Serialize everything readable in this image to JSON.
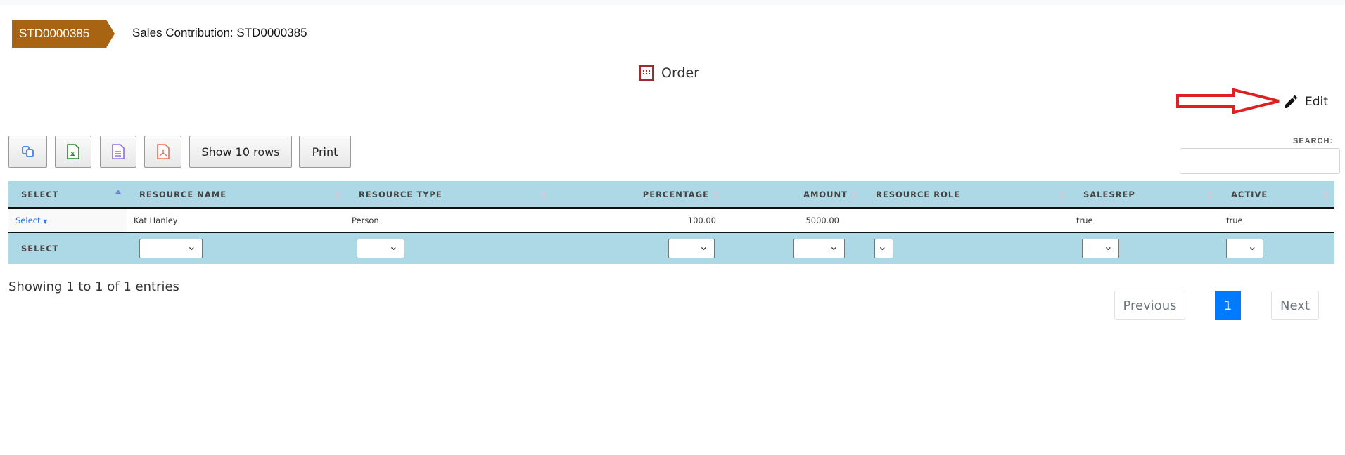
{
  "record": {
    "badge": "STD0000385",
    "title": "Sales Contribution: STD0000385"
  },
  "tab": {
    "label": "Order"
  },
  "edit": {
    "label": "Edit"
  },
  "toolbar": {
    "copy_icon": "copy-icon",
    "excel_icon": "excel-icon",
    "csv_icon": "csv-icon",
    "pdf_icon": "pdf-icon",
    "show_rows": "Show 10 rows",
    "print": "Print"
  },
  "search": {
    "label": "SEARCH:",
    "value": ""
  },
  "table": {
    "columns": [
      "SELECT",
      "RESOURCE NAME",
      "RESOURCE TYPE",
      "PERCENTAGE",
      "AMOUNT",
      "RESOURCE ROLE",
      "SALESREP",
      "ACTIVE"
    ],
    "rows": [
      {
        "select": "Select",
        "resource_name": "Kat Hanley",
        "resource_type": "Person",
        "percentage": "100.00",
        "amount": "5000.00",
        "resource_role": "",
        "salesrep": "true",
        "active": "true"
      }
    ],
    "footer_label": "SELECT"
  },
  "info": "Showing 1 to 1 of 1 entries",
  "pagination": {
    "previous": "Previous",
    "current": "1",
    "next": "Next"
  },
  "colors": {
    "badge": "#a86412",
    "header": "#add8e6",
    "accent": "#007bff",
    "annotation_arrow": "#e02020"
  }
}
